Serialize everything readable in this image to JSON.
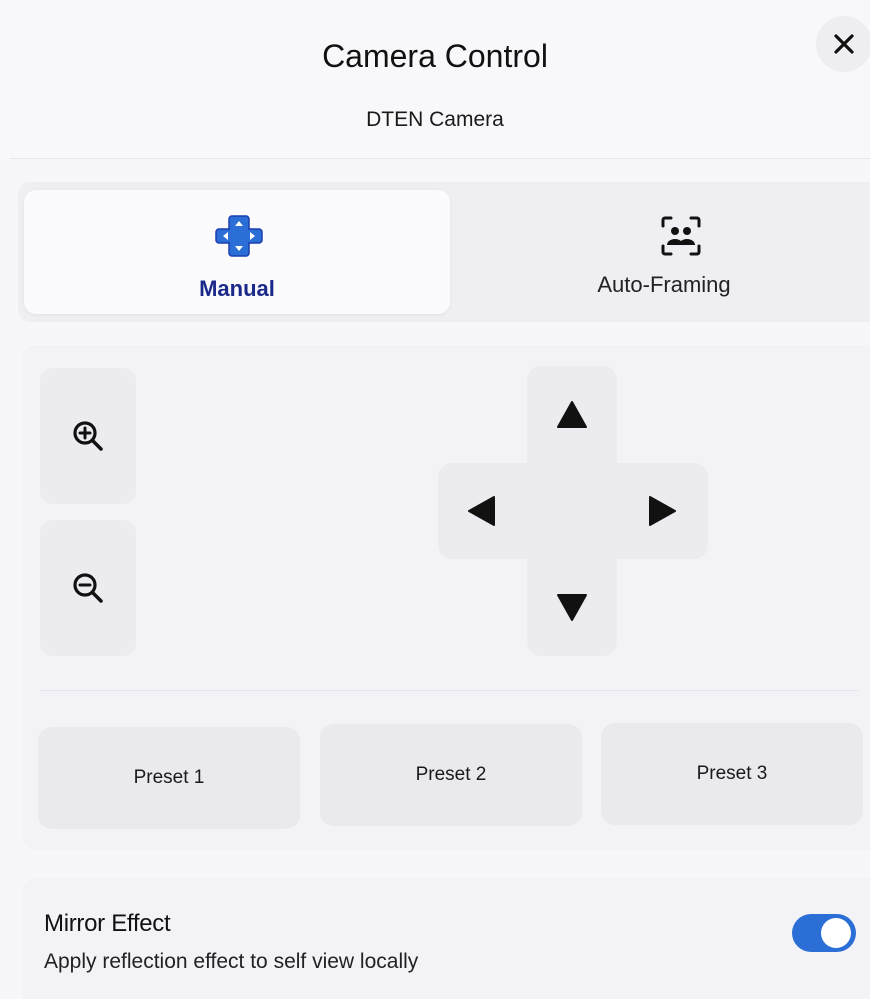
{
  "header": {
    "title": "Camera Control",
    "subtitle": "DTEN Camera"
  },
  "close_icon": "close-icon",
  "mode_tabs": [
    {
      "label": "Manual",
      "icon": "dpad-icon",
      "selected": true
    },
    {
      "label": "Auto-Framing",
      "icon": "auto-framing-icon",
      "selected": false
    }
  ],
  "zoom": {
    "in_icon": "zoom-in-icon",
    "out_icon": "zoom-out-icon"
  },
  "dpad": {
    "up_icon": "arrow-up-icon",
    "down_icon": "arrow-down-icon",
    "left_icon": "arrow-left-icon",
    "right_icon": "arrow-right-icon"
  },
  "presets": [
    {
      "label": "Preset 1"
    },
    {
      "label": "Preset 2"
    },
    {
      "label": "Preset 3"
    }
  ],
  "mirror": {
    "title": "Mirror Effect",
    "description": "Apply reflection effect to self view locally",
    "enabled": true
  },
  "colors": {
    "accent": "#2b6fd6",
    "manual_label": "#1b2a8a",
    "dpad_icon": "#2b6fd6"
  }
}
